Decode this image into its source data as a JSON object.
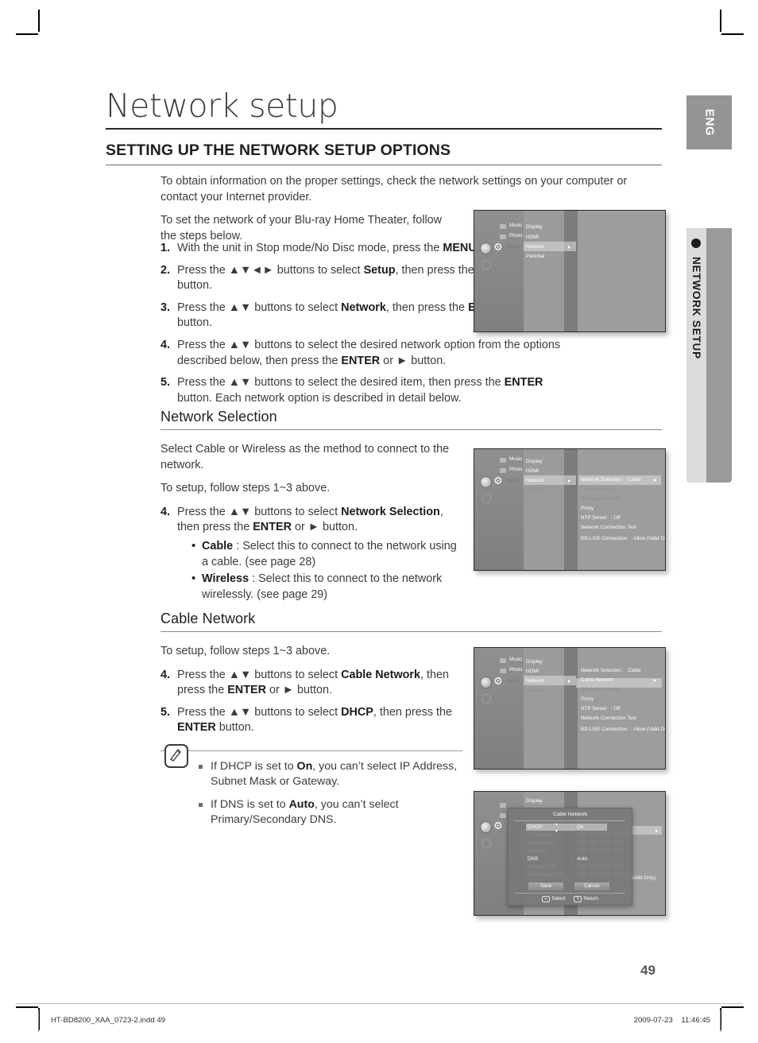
{
  "header": {
    "title": "Network setup",
    "section_title": "SETTING UP THE NETWORK SETUP OPTIONS",
    "lang_tab": "ENG",
    "side_tab": "NETWORK SETUP"
  },
  "intro": {
    "p1": "To obtain information on the proper settings, check the network settings on your computer or contact your Internet provider.",
    "p2": "To set the network of your Blu-ray Home Theater, follow the steps below."
  },
  "main_steps": [
    {
      "num": "1.",
      "html": "With the unit in Stop mode/No Disc mode, press the <b>MENU</b> button."
    },
    {
      "num": "2.",
      "html": "Press the ▲▼◄► buttons to select <b>Setup</b>, then press the <b>ENTER</b> or ► button."
    },
    {
      "num": "3.",
      "html": "Press the ▲▼ buttons to select <b>Network</b>, then press the <b>ENTER</b> or ► button."
    },
    {
      "num": "4.",
      "html": "Press the ▲▼ buttons to select the desired network option from the options described below, then press the <b>ENTER</b> or ► button."
    },
    {
      "num": "5.",
      "html": "Press the ▲▼ buttons to select the desired item, then press the <b>ENTER</b> button. Each network option is described in detail below."
    }
  ],
  "network_selection": {
    "heading": "Network Selection",
    "p1": "Select Cable or Wireless as the method to connect to the network.",
    "p2": "To setup, follow steps 1~3 above.",
    "step": {
      "num": "4.",
      "html": "Press the ▲▼ buttons to select <b>Network Selection</b>, then press the <b>ENTER</b> or ► button."
    },
    "bullets": [
      "<b>Cable</b> : Select this to connect to the network using a cable. (see page 28)",
      "<b>Wireless</b> : Select this to connect to the network wirelessly. (see page 29)"
    ]
  },
  "cable_network": {
    "heading": "Cable Network",
    "p1": "To setup, follow steps 1~3 above.",
    "steps": [
      {
        "num": "4.",
        "html": "Press the ▲▼ buttons to select <b>Cable Network</b>, then press the <b>ENTER</b> or ► button."
      },
      {
        "num": "5.",
        "html": "Press the ▲▼ buttons to select <b>DHCP</b>, then press the <b>ENTER</b> button."
      }
    ]
  },
  "note": {
    "icon": "note-pen-icon",
    "items": [
      "If DHCP is set to <b>On</b>, you can’t select IP Address, Subnet Mask or Gateway.",
      "If DNS is set to <b>Auto</b>, you can’t select Primary/Secondary DNS."
    ]
  },
  "screenshots": {
    "common": {
      "left_items": [
        "Music",
        "Photo",
        "Setup"
      ],
      "mid_items": [
        "Display",
        "HDMI",
        "Network",
        "Parental"
      ]
    },
    "shot1": {
      "mid_selected": "Network",
      "right_items": []
    },
    "shot2": {
      "mid_selected": "Network",
      "right_items": [
        {
          "label": "Network Selection :",
          "value": "Cable",
          "state": "selected",
          "arrow": true
        },
        {
          "label": "Cable Network",
          "value": "",
          "state": "dim"
        },
        {
          "label": "Wireless Network",
          "value": "",
          "state": "dim"
        },
        {
          "label": "Proxy",
          "value": "",
          "state": "normal"
        },
        {
          "label": "NTP Server",
          "value": ": Off",
          "state": "normal"
        },
        {
          "label": "Network Connection Test",
          "value": "",
          "state": "normal"
        },
        {
          "label": "BD-LIVE Connection",
          "value": ": Allow (Valid Only)",
          "state": "normal"
        }
      ]
    },
    "shot3": {
      "mid_selected": "Network",
      "right_items": [
        {
          "label": "Network Selection :",
          "value": "Cable",
          "state": "normal"
        },
        {
          "label": "Cable Network",
          "value": "",
          "state": "selected",
          "arrow": true
        },
        {
          "label": "Wireless Network",
          "value": "",
          "state": "dim"
        },
        {
          "label": "Proxy",
          "value": "",
          "state": "normal"
        },
        {
          "label": "NTP Server",
          "value": ": Off",
          "state": "normal"
        },
        {
          "label": "Network Connection Test",
          "value": "",
          "state": "normal"
        },
        {
          "label": "BD-LIVE Connection",
          "value": ": Allow (Valid Only)",
          "state": "normal"
        }
      ]
    },
    "shot4": {
      "dialog_title": "Cable Network",
      "rows": [
        {
          "key": "DHCP",
          "colon": ":",
          "value": "On",
          "state": "on",
          "selected": true
        },
        {
          "key": "IP Address",
          "colon": ":",
          "value": "000 . 000 . 000 . 000",
          "state": "off"
        },
        {
          "key": "Subnet Mask",
          "colon": ":",
          "value": "255 . 255 . 255 . 000",
          "state": "off"
        },
        {
          "key": "Gateway",
          "colon": ":",
          "value": "000 . 000 . 000 . 000",
          "state": "off"
        },
        {
          "key": "DNS",
          "colon": ":",
          "value": "Auto",
          "state": "on"
        },
        {
          "key": "Primary DNS",
          "colon": ":",
          "value": "000 . 000 . 000 . 000",
          "state": "off"
        },
        {
          "key": "Secondary DNS",
          "colon": ":",
          "value": "000 . 000 . 000 . 000",
          "state": "off"
        }
      ],
      "save_label": "Save",
      "cancel_label": "Cancel",
      "select_label": "Select",
      "return_label": "Return",
      "behind_text": "(Valid Only)"
    }
  },
  "footer": {
    "page_number": "49",
    "file_name": "HT-BD8200_XAA_0723-2.indd   49",
    "date": "2009-07-23",
    "time": "11:46:45"
  }
}
